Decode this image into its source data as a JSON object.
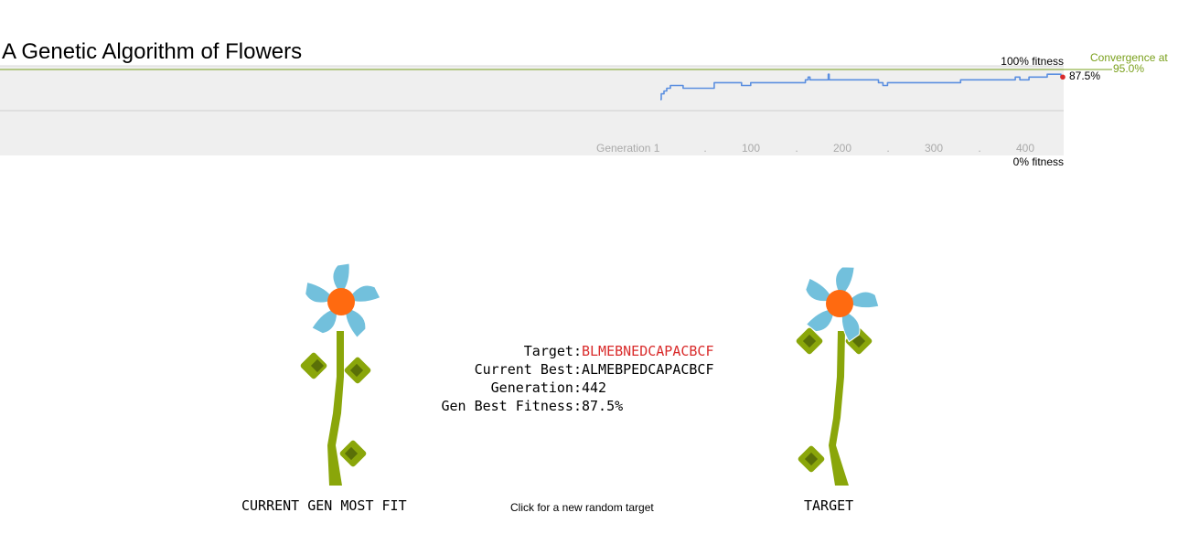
{
  "page": {
    "title": "A Genetic Algorithm of Flowers"
  },
  "chart": {
    "top_label": "100% fitness",
    "bottom_label": "0% fitness",
    "convergence_label_1": "Convergence at",
    "convergence_label_2": "95.0%",
    "current_value_label": "87.5%",
    "x_first_label": "Generation 1",
    "x_labels": [
      "100",
      "200",
      "300",
      "400"
    ],
    "colors": {
      "line": "#5b8fe0",
      "convergence": "#7aa01c",
      "marker": "#d92b2b",
      "band": "#efefef"
    }
  },
  "chart_data": {
    "type": "line",
    "title": "",
    "xlabel": "",
    "ylabel": "",
    "xlim": [
      1,
      442
    ],
    "ylim": [
      0,
      100
    ],
    "convergence": 95.0,
    "x_tick_labels": [
      "Generation 1",
      "100",
      "200",
      "300",
      "400"
    ],
    "series": [
      {
        "x": [
          1,
          2,
          5,
          8,
          12,
          16,
          20,
          26,
          30,
          40,
          50,
          60,
          66,
          70,
          80,
          90,
          100,
          120,
          140,
          160,
          163,
          165,
          170,
          175,
          185,
          186,
          190,
          200,
          220,
          240,
          245,
          250,
          260,
          270,
          280,
          300,
          310,
          320,
          330,
          340,
          360,
          380,
          390,
          395,
          400,
          405,
          410,
          415,
          420,
          425,
          430,
          435,
          440,
          442
        ],
        "values": [
          62.5,
          68.8,
          71.9,
          75.0,
          78.1,
          78.1,
          78.1,
          75.0,
          75.0,
          75.0,
          75.0,
          81.2,
          81.2,
          81.2,
          81.2,
          78.1,
          81.2,
          81.2,
          81.2,
          84.4,
          87.5,
          84.4,
          84.4,
          84.4,
          90.6,
          84.4,
          84.4,
          84.4,
          84.4,
          81.2,
          78.1,
          81.2,
          81.2,
          81.2,
          81.2,
          81.2,
          81.2,
          81.2,
          84.4,
          84.4,
          84.4,
          84.4,
          87.5,
          84.4,
          84.4,
          87.5,
          87.5,
          87.5,
          87.5,
          90.6,
          90.6,
          90.6,
          87.5,
          87.5
        ]
      }
    ]
  },
  "stats": {
    "target_label": "Target:",
    "target_value": "BLMEBNEDCAPACBCF",
    "current_best_label": "Current Best:",
    "current_best_value": "ALMEBPEDCAPACBCF",
    "generation_label": "Generation:",
    "generation_value": "442",
    "gen_best_fitness_label": "Gen Best Fitness:",
    "gen_best_fitness_value": "87.5%",
    "target_color": "#d92b2b"
  },
  "captions": {
    "current": "CURRENT GEN MOST FIT",
    "target": "TARGET",
    "click": "Click for a new random target"
  },
  "flower_colors": {
    "petal": "#72c0dc",
    "center": "#ff6a10",
    "stem": "#8aa60a",
    "leaf": "#8aa60a",
    "leaf_inner": "#5a7008"
  }
}
